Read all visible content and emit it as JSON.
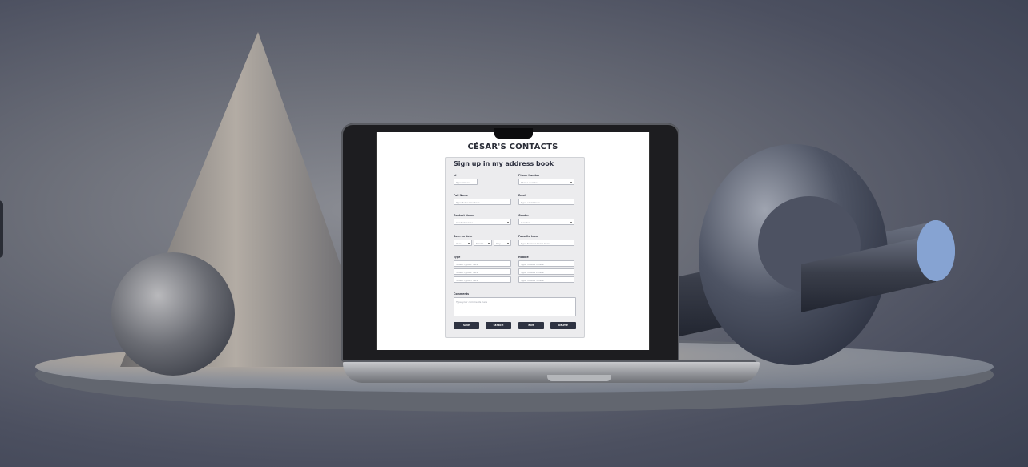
{
  "app": {
    "title": "CÉSAR'S CONTACTS",
    "form_title": "Sign up in my address book"
  },
  "form": {
    "id": {
      "label": "Id",
      "placeholder": "Type id here"
    },
    "phone": {
      "label": "Phone Number",
      "placeholder": "Phone number"
    },
    "full_name": {
      "label": "Full Name",
      "placeholder": "Type full name here"
    },
    "email": {
      "label": "Email",
      "placeholder": "Type email here"
    },
    "contact_name": {
      "label": "Contact Name",
      "placeholder": "Contact name"
    },
    "gender": {
      "label": "Gender",
      "placeholder": "Gender"
    },
    "born_on": {
      "label": "Born on date",
      "year": "Year",
      "month": "Month",
      "day": "Day"
    },
    "favorite_team": {
      "label": "Favorite team",
      "placeholder": "Type favorite team here"
    },
    "type": {
      "label": "Type",
      "items": [
        "Select type 1 here",
        "Select type 2 here",
        "Select type 3 here"
      ]
    },
    "hobbie": {
      "label": "Hobbie",
      "items": [
        "Type hobbie 1 here",
        "Type hobbie 2 here",
        "Type hobbie 3 here"
      ]
    },
    "comments": {
      "label": "Comments",
      "placeholder": "Type your comments here"
    }
  },
  "buttons": {
    "save": "SAVE",
    "search": "SEARCH",
    "edit": "EDIT",
    "delete": "DELETE"
  },
  "colors": {
    "button": "#2e3342",
    "background": "#4c5060"
  }
}
